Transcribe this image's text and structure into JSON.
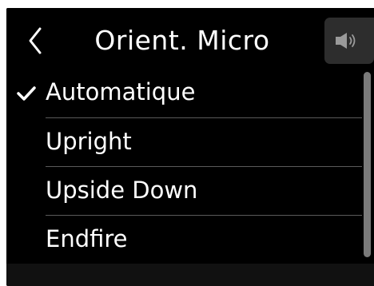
{
  "header": {
    "title": "Orient. Micro",
    "back_icon": "chevron-left-icon",
    "speaker_icon": "speaker-icon"
  },
  "options": [
    {
      "label": "Automatique",
      "selected": true
    },
    {
      "label": "Upright",
      "selected": false
    },
    {
      "label": "Upside Down",
      "selected": false
    },
    {
      "label": "Endfire",
      "selected": false
    }
  ],
  "colors": {
    "background": "#000000",
    "text": "#ffffff",
    "divider": "#5a5a5a",
    "scrollbar": "#7a7a7a",
    "speaker_button": "#2d2d2d"
  }
}
